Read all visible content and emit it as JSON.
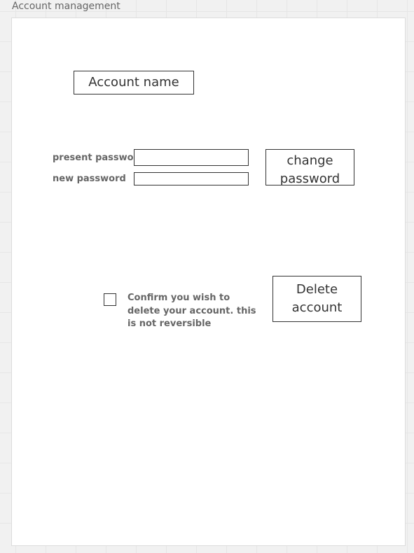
{
  "frame": {
    "title": "Account management"
  },
  "account": {
    "name_label": "Account name"
  },
  "password": {
    "present_label": "present password",
    "present_value": "",
    "new_label": "new password",
    "new_value": "",
    "change_button_label": "change password"
  },
  "delete": {
    "confirm_checked": false,
    "confirm_text": "Confirm you wish to delete your account. this is not reversible",
    "button_label": "Delete account"
  }
}
